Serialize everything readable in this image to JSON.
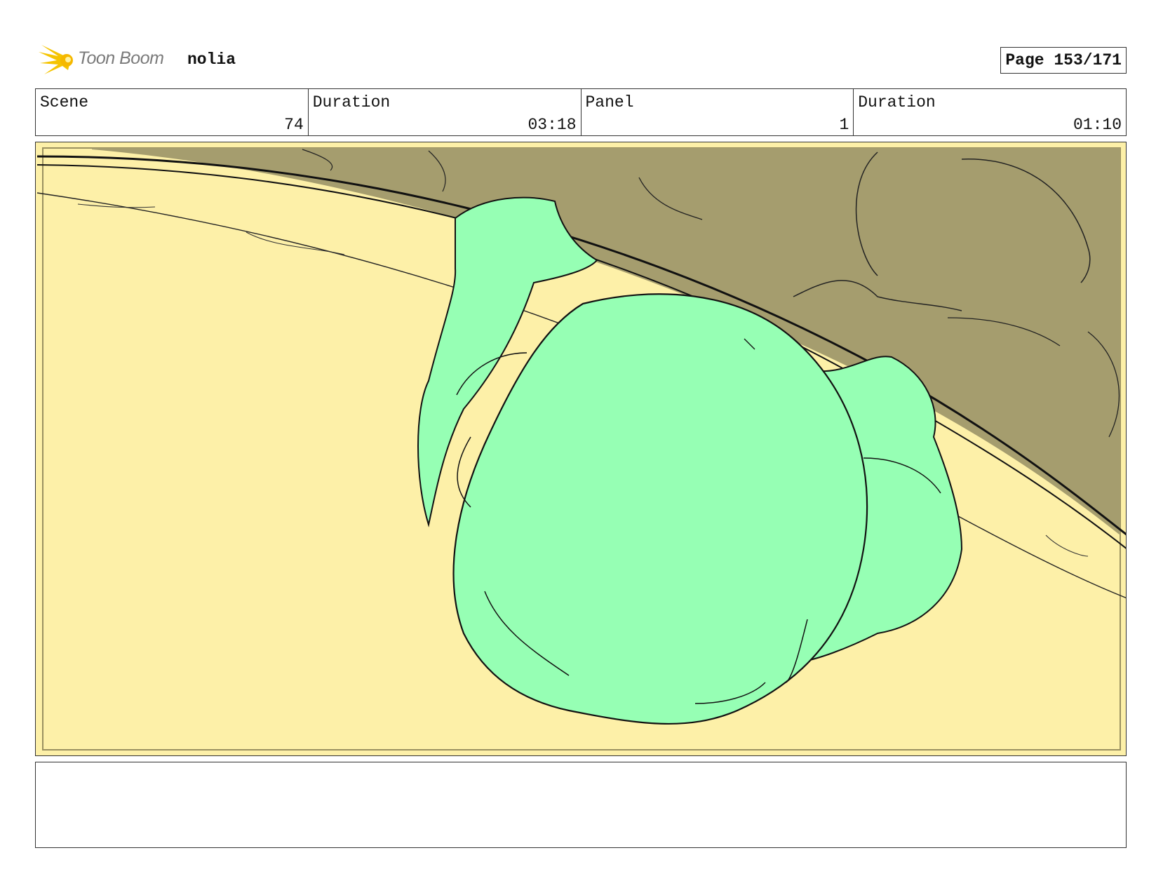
{
  "header": {
    "logo_text": "Toon Boom",
    "project_name": "nolia",
    "page_label": "Page 153/171"
  },
  "info": {
    "scene_label": "Scene",
    "scene_value": "74",
    "scene_duration_label": "Duration",
    "scene_duration_value": "03:18",
    "panel_label": "Panel",
    "panel_value": "1",
    "panel_duration_label": "Duration",
    "panel_duration_value": "01:10"
  },
  "notes": {
    "text": ""
  },
  "colors": {
    "floor": "#fdf0a8",
    "wall": "#a59d6e",
    "character": "#96ffb4",
    "line": "#111111",
    "logo_star": "#f5b800"
  },
  "icons": {
    "logo": "toon-boom-starburst-icon"
  }
}
